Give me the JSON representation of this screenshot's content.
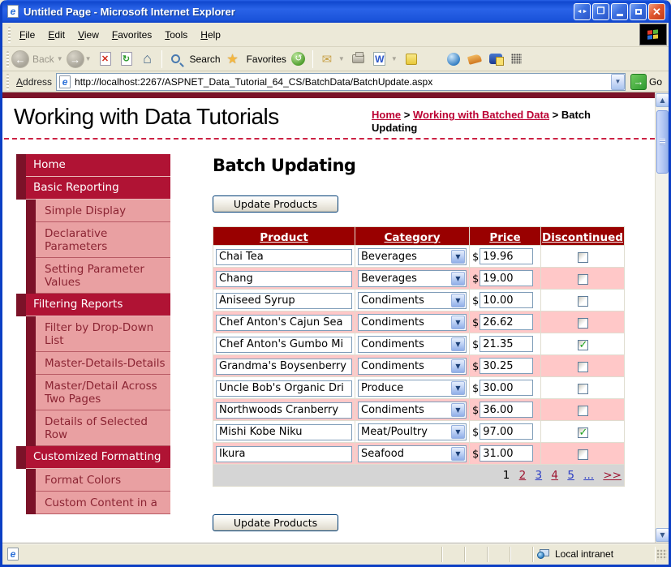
{
  "window": {
    "title": "Untitled Page - Microsoft Internet Explorer"
  },
  "menu": {
    "items": [
      "File",
      "Edit",
      "View",
      "Favorites",
      "Tools",
      "Help"
    ]
  },
  "toolbar": {
    "back_label": "Back",
    "search_label": "Search",
    "favorites_label": "Favorites"
  },
  "address": {
    "label": "Address",
    "url": "http://localhost:2267/ASPNET_Data_Tutorial_64_CS/BatchData/BatchUpdate.aspx",
    "go_label": "Go"
  },
  "icons": {
    "back_arrow": "←",
    "forward_arrow": "→",
    "stop": "✕",
    "refresh": "↻",
    "home": "⌂",
    "star": "★",
    "history": "↺",
    "mail": "✉",
    "word": "W",
    "chevron_down": "▼",
    "scroll_up": "▲",
    "scroll_down": "▼",
    "go_arrow": "→",
    "close": "✕",
    "pane_arrows": "◄►",
    "detach": "❐",
    "ie_e": "e"
  },
  "colors": {
    "brand_maroon": "#7b1228",
    "sidebar_crimson": "#b01334",
    "sidebar_pink": "#e9a0a2",
    "table_header_red": "#990000",
    "row_pink": "#ffc8c8",
    "link_red": "#bb0032",
    "pager_blue": "#2b3cc4",
    "check_green": "#1fa41f"
  },
  "page": {
    "site_title": "Working with Data Tutorials",
    "breadcrumb": {
      "sep": ">",
      "items": [
        {
          "label": "Home"
        },
        {
          "label": "Working with Batched Data"
        },
        {
          "label": "Batch Updating"
        }
      ]
    },
    "heading": "Batch Updating",
    "update_button_label": "Update Products",
    "sidebar": [
      {
        "label": "Home",
        "level": 1
      },
      {
        "label": "Basic Reporting",
        "level": 1
      },
      {
        "label": "Simple Display",
        "level": 2
      },
      {
        "label": "Declarative Parameters",
        "level": 2
      },
      {
        "label": "Setting Parameter Values",
        "level": 2
      },
      {
        "label": "Filtering Reports",
        "level": 1
      },
      {
        "label": "Filter by Drop-Down List",
        "level": 2
      },
      {
        "label": "Master-Details-Details",
        "level": 2
      },
      {
        "label": "Master/Detail Across Two Pages",
        "level": 2
      },
      {
        "label": "Details of Selected Row",
        "level": 2
      },
      {
        "label": "Customized Formatting",
        "level": 1
      },
      {
        "label": "Format Colors",
        "level": 2
      },
      {
        "label": "Custom Content in a",
        "level": 2
      }
    ],
    "table": {
      "headers": [
        "Product",
        "Category",
        "Price",
        "Discontinued"
      ],
      "currency": "$",
      "rows": [
        {
          "product": "Chai Tea",
          "category": "Beverages",
          "price": "19.96",
          "discontinued": false
        },
        {
          "product": "Chang",
          "category": "Beverages",
          "price": "19.00",
          "discontinued": false
        },
        {
          "product": "Aniseed Syrup",
          "category": "Condiments",
          "price": "10.00",
          "discontinued": false
        },
        {
          "product": "Chef Anton's Cajun Sea",
          "category": "Condiments",
          "price": "26.62",
          "discontinued": false
        },
        {
          "product": "Chef Anton's Gumbo Mi",
          "category": "Condiments",
          "price": "21.35",
          "discontinued": true
        },
        {
          "product": "Grandma's Boysenberry",
          "category": "Condiments",
          "price": "30.25",
          "discontinued": false
        },
        {
          "product": "Uncle Bob's Organic Dri",
          "category": "Produce",
          "price": "30.00",
          "discontinued": false
        },
        {
          "product": "Northwoods Cranberry",
          "category": "Condiments",
          "price": "36.00",
          "discontinued": false
        },
        {
          "product": "Mishi Kobe Niku",
          "category": "Meat/Poultry",
          "price": "97.00",
          "discontinued": true
        },
        {
          "product": "Ikura",
          "category": "Seafood",
          "price": "31.00",
          "discontinued": false
        }
      ],
      "pager": [
        {
          "label": "1",
          "style": "current"
        },
        {
          "label": "2",
          "style": "red"
        },
        {
          "label": "3",
          "style": "blue"
        },
        {
          "label": "4",
          "style": "red"
        },
        {
          "label": "5",
          "style": "blue"
        },
        {
          "label": "...",
          "style": "blue"
        },
        {
          "label": ">>",
          "style": "red"
        }
      ]
    }
  },
  "statusbar": {
    "zone": "Local intranet"
  }
}
